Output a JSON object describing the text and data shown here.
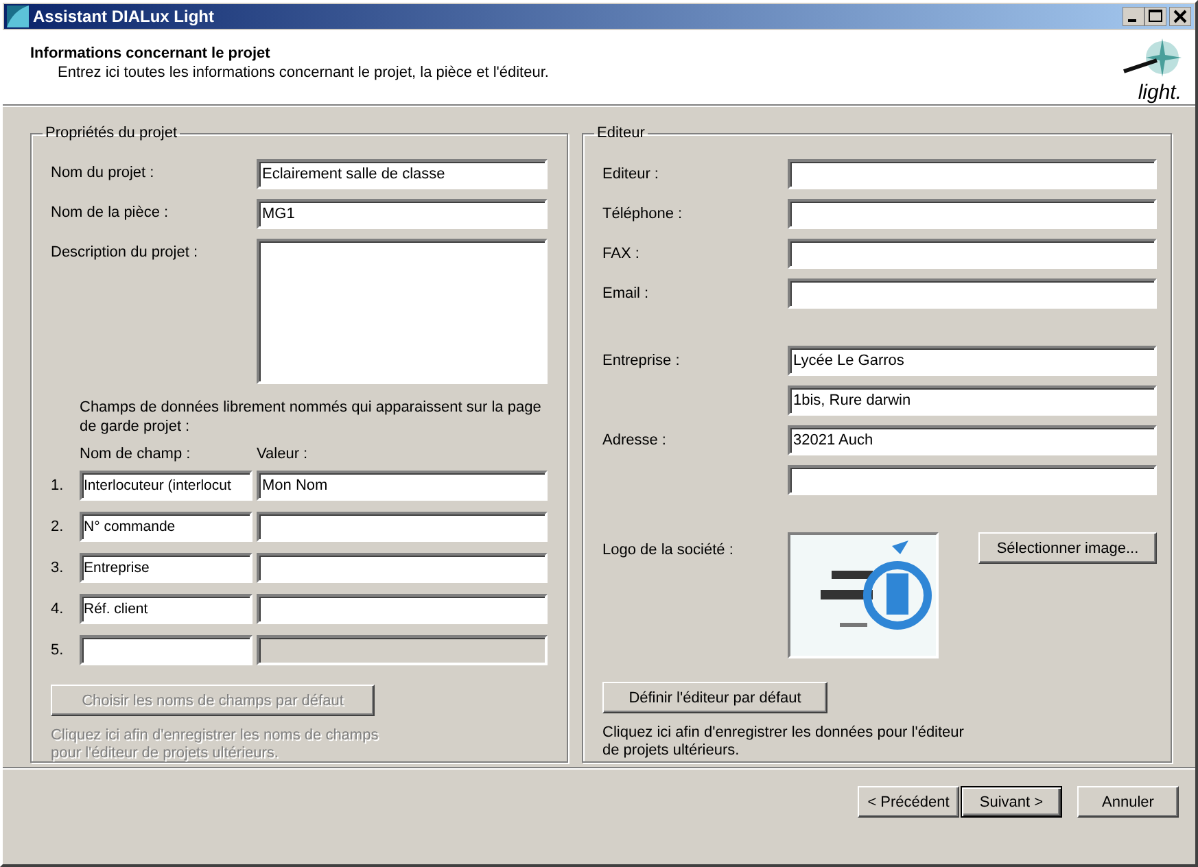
{
  "window": {
    "title": "Assistant DIALux Light"
  },
  "header": {
    "title": "Informations concernant le projet",
    "subtitle": "Entrez ici toutes les informations concernant le projet, la pièce et l'éditeur.",
    "logo_text": "light."
  },
  "project": {
    "legend": "Propriétés du projet",
    "fields": [
      {
        "kind": "line",
        "label": "Nom du projet :",
        "value": "Eclairement salle de classe"
      },
      {
        "kind": "line",
        "label": "Nom de la pièce :",
        "value": "MG1"
      },
      {
        "kind": "multiline",
        "label": "Description du projet :"
      }
    ],
    "custom_intro": "Champs de données librement nommés qui apparaissent sur la page de garde projet :",
    "custom_headers": [
      "Nom de champ :",
      "Valeur :"
    ],
    "custom_fields": [
      {
        "number": "1.",
        "name": "Interlocuteur (interlocut",
        "value": "Mon Nom",
        "disabled": false
      },
      {
        "number": "2.",
        "name": "N° commande",
        "disabled": false
      },
      {
        "number": "3.",
        "name": "Entreprise",
        "disabled": false
      },
      {
        "number": "4.",
        "name": "Réf. client",
        "disabled": false
      },
      {
        "number": "5.",
        "disabled": true
      }
    ],
    "default_button": {
      "label": "Choisir les noms de champs par défaut",
      "disabled": true
    },
    "help": {
      "text": "Cliquez ici afin d'enregistrer les noms de champs pour l'éditeur de projets ultérieurs.",
      "disabled": true
    }
  },
  "editor": {
    "legend": "Editeur",
    "contact_fields": [
      {
        "kind": "line",
        "label": "Editeur :"
      },
      {
        "kind": "line",
        "label": "Téléphone :"
      },
      {
        "kind": "line",
        "label": "FAX :"
      },
      {
        "kind": "line",
        "label": "Email :"
      }
    ],
    "company_fields": [
      {
        "kind": "line",
        "label": "Entreprise :",
        "value": "Lycée Le Garros"
      },
      {
        "kind": "line",
        "value": "1bis, Rure darwin"
      },
      {
        "kind": "line",
        "label": "Adresse :",
        "value": "32021 Auch"
      },
      {
        "kind": "line"
      }
    ],
    "logo": {
      "label": "Logo de la société :",
      "button": "Sélectionner image..."
    },
    "default_button": {
      "label": "Définir l'éditeur par défaut",
      "disabled": false
    },
    "help": {
      "text": "Cliquez ici afin d'enregistrer les données pour l'éditeur de projets ultérieurs.",
      "disabled": false
    }
  },
  "buttons": [
    {
      "label": "< Précédent",
      "default": false
    },
    {
      "label": "Suivant >",
      "default": true
    },
    {
      "label": "Annuler",
      "default": false
    }
  ]
}
